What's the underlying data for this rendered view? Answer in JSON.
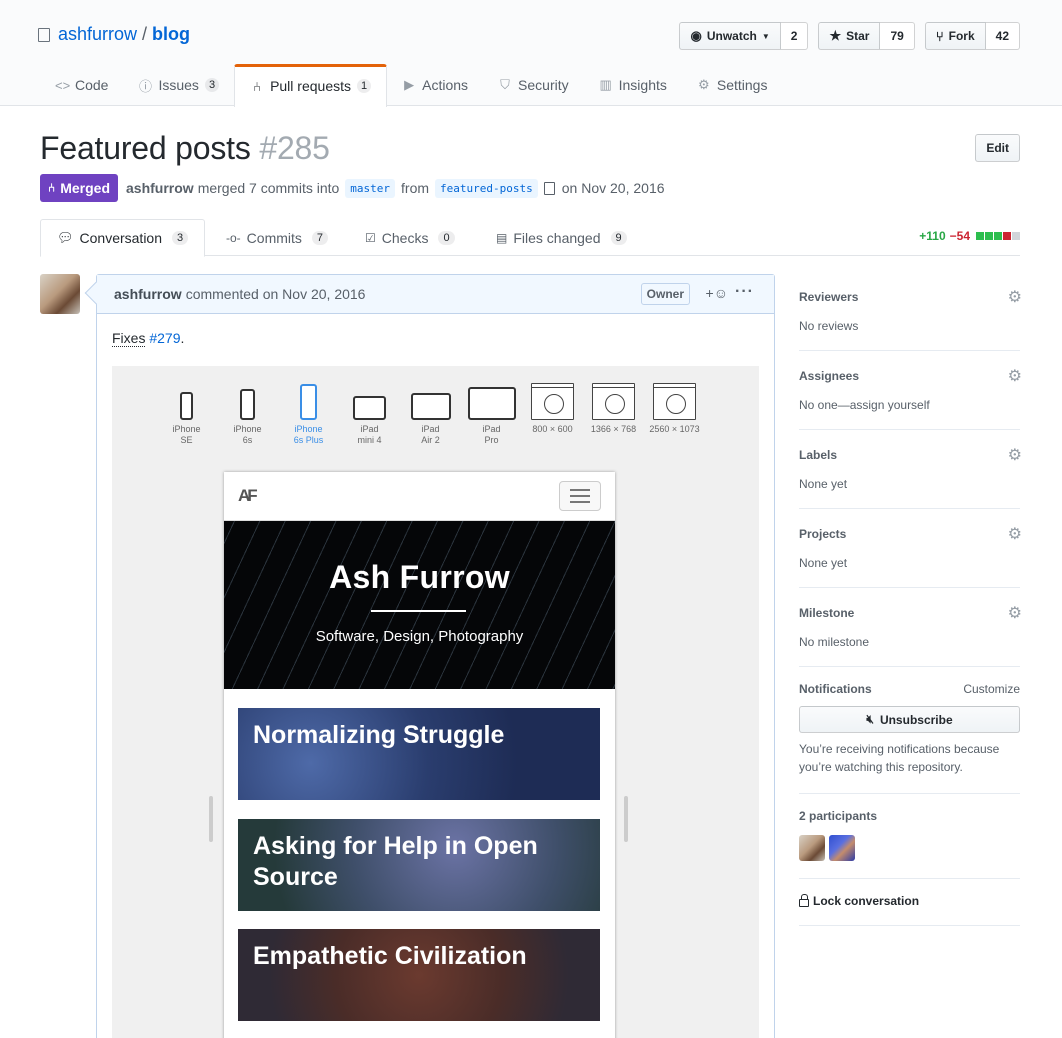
{
  "repo": {
    "owner": "ashfurrow",
    "separator": "/",
    "name": "blog"
  },
  "actions": {
    "watch": {
      "label": "Unwatch",
      "count": "2"
    },
    "star": {
      "label": "Star",
      "count": "79"
    },
    "fork": {
      "label": "Fork",
      "count": "42"
    }
  },
  "nav": [
    {
      "label": "Code",
      "count": null,
      "icon": "code-icon"
    },
    {
      "label": "Issues",
      "count": "3",
      "icon": "issue-icon"
    },
    {
      "label": "Pull requests",
      "count": "1",
      "icon": "pull-request-icon"
    },
    {
      "label": "Actions",
      "count": null,
      "icon": "play-icon"
    },
    {
      "label": "Security",
      "count": null,
      "icon": "shield-icon"
    },
    {
      "label": "Insights",
      "count": null,
      "icon": "graph-icon"
    },
    {
      "label": "Settings",
      "count": null,
      "icon": "gear-icon"
    }
  ],
  "pr": {
    "title": "Featured posts",
    "number": "#285",
    "edit_label": "Edit",
    "state": "Merged",
    "author": "ashfurrow",
    "merged_text": "merged 7 commits into",
    "base_branch": "master",
    "from_text": "from",
    "head_branch": "featured-posts",
    "date_text": "on Nov 20, 2016"
  },
  "tabs": [
    {
      "label": "Conversation",
      "count": "3",
      "icon": "comment-icon"
    },
    {
      "label": "Commits",
      "count": "7",
      "icon": "commit-icon"
    },
    {
      "label": "Checks",
      "count": "0",
      "icon": "checklist-icon"
    },
    {
      "label": "Files changed",
      "count": "9",
      "icon": "file-diff-icon"
    }
  ],
  "diffstat": {
    "additions": "+110",
    "deletions": "−54"
  },
  "comment": {
    "author": "ashfurrow",
    "header_text": "commented on Nov 20, 2016",
    "badge": "Owner",
    "react": "+☺",
    "more": "···",
    "body_prefix": "Fixes",
    "issue_link": "#279",
    "body_suffix": "."
  },
  "screenshot": {
    "devices": [
      {
        "line1": "iPhone",
        "line2": "SE"
      },
      {
        "line1": "iPhone",
        "line2": "6s"
      },
      {
        "line1": "iPhone",
        "line2": "6s Plus"
      },
      {
        "line1": "iPad",
        "line2": "mini 4"
      },
      {
        "line1": "iPad",
        "line2": "Air 2"
      },
      {
        "line1": "iPad",
        "line2": "Pro"
      },
      {
        "line1": "800 × 600",
        "line2": ""
      },
      {
        "line1": "1366 × 768",
        "line2": ""
      },
      {
        "line1": "2560 × 1073",
        "line2": ""
      }
    ],
    "site_logo": "AF",
    "hero_title": "Ash Furrow",
    "hero_subtitle": "Software, Design, Photography",
    "posts": [
      "Normalizing Struggle",
      "Asking for Help in Open Source",
      "Empathetic Civilization"
    ]
  },
  "sidebar": {
    "reviewers": {
      "title": "Reviewers",
      "value": "No reviews"
    },
    "assignees": {
      "title": "Assignees",
      "value": "No one—assign yourself"
    },
    "labels": {
      "title": "Labels",
      "value": "None yet"
    },
    "projects": {
      "title": "Projects",
      "value": "None yet"
    },
    "milestone": {
      "title": "Milestone",
      "value": "No milestone"
    },
    "notifications": {
      "title": "Notifications",
      "customize": "Customize",
      "button": "Unsubscribe",
      "note": "You’re receiving notifications because you’re watching this repository."
    },
    "participants": {
      "title": "2 participants"
    },
    "lock": "Lock conversation"
  },
  "colors": {
    "merged": "#6f42c1",
    "link": "#0366d6",
    "add": "#28a745",
    "del": "#cb2431",
    "nav_accent": "#e36209"
  }
}
